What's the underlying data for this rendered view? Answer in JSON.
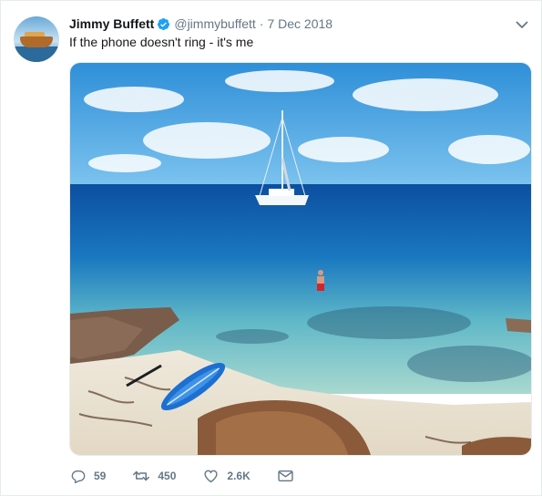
{
  "author": {
    "name": "Jimmy Buffett",
    "handle": "@jimmybuffett",
    "date": "7 Dec 2018",
    "verified": true
  },
  "tweet": {
    "text": "If the phone doesn't ring - it's me"
  },
  "actions": {
    "replies": "59",
    "retweets": "450",
    "likes": "2.6K"
  },
  "icons": {
    "verified": "verified-badge-icon",
    "menu": "chevron-down-icon",
    "reply": "reply-icon",
    "retweet": "retweet-icon",
    "like": "heart-icon",
    "dm": "envelope-icon"
  },
  "colors": {
    "accent": "#1da1f2",
    "muted": "#657786",
    "text": "#14171a"
  }
}
